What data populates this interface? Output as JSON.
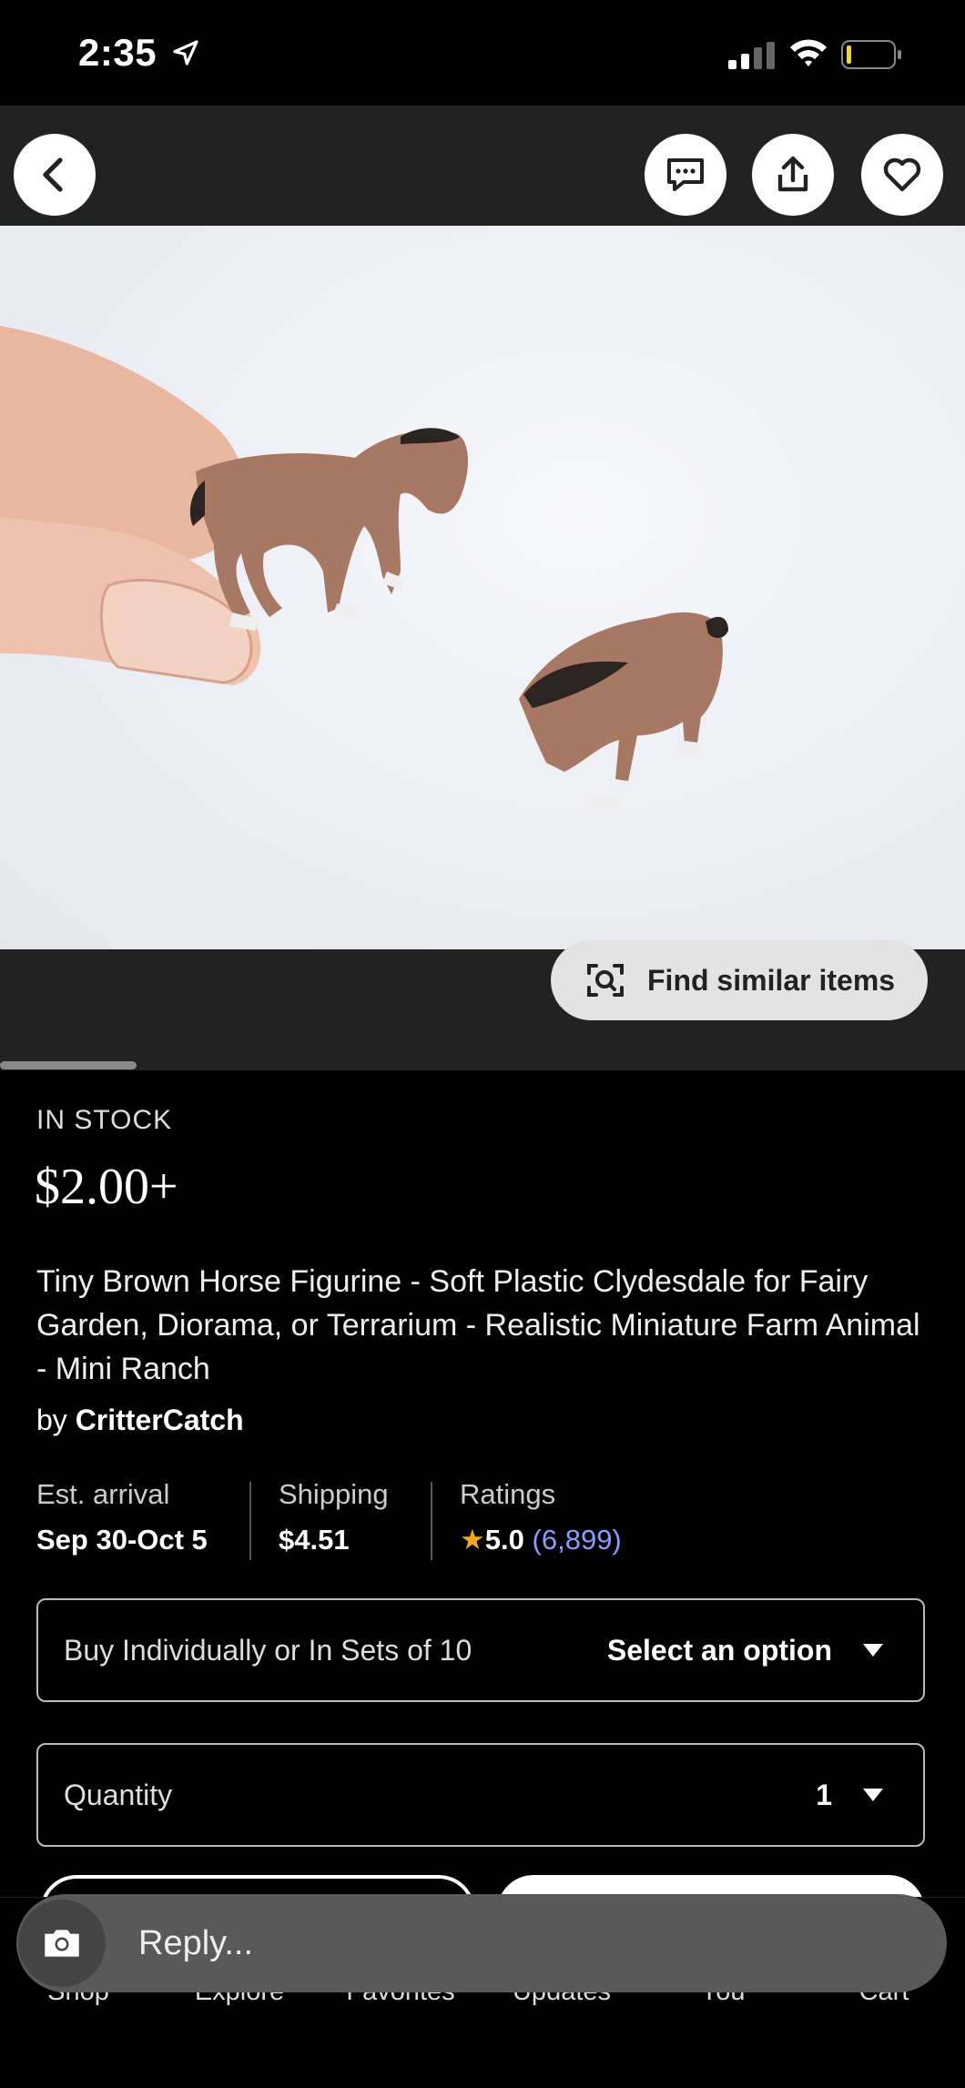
{
  "status_bar": {
    "time": "2:35"
  },
  "find_similar_label": "Find similar items",
  "listing": {
    "stock": "IN STOCK",
    "price": "$2.00+",
    "title": "Tiny Brown Horse Figurine -  Soft Plastic Clydesdale for Fairy Garden, Diorama, or Terrarium - Realistic Miniature Farm Animal - Mini Ranch",
    "by_prefix": "by",
    "shop": "CritterCatch"
  },
  "info": {
    "arrival_label": "Est. arrival",
    "arrival_value": "Sep 30-Oct 5",
    "shipping_label": "Shipping",
    "shipping_value": "$4.51",
    "ratings_label": "Ratings",
    "rating_value": "5.0",
    "rating_count": "(6,899)"
  },
  "variation": {
    "label": "Buy Individually or In Sets of 10",
    "value": "Select an option"
  },
  "quantity": {
    "label": "Quantity",
    "value": "1"
  },
  "reply": {
    "placeholder": "Reply..."
  },
  "tabs": [
    "Shop",
    "Explore",
    "Favorites",
    "Updates",
    "You",
    "Cart"
  ],
  "colors": {
    "accent_link": "#8a9cff",
    "star": "#f5a623"
  }
}
